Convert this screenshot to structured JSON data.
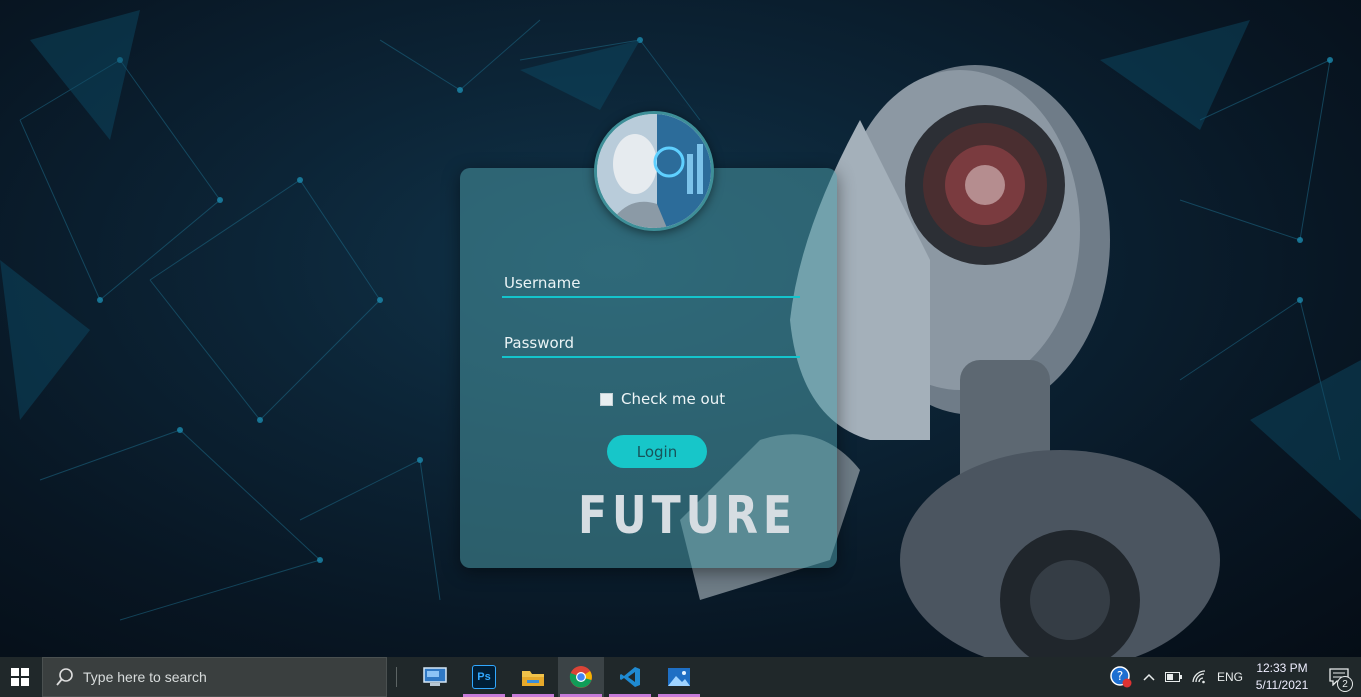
{
  "login": {
    "username_placeholder": "Username",
    "password_placeholder": "Password",
    "checkbox_label": "Check me out",
    "login_label": "Login",
    "brand_text": "FUTURE"
  },
  "taskbar": {
    "search_placeholder": "Type here to search",
    "apps": [
      {
        "name": "remote-desktop-icon"
      },
      {
        "name": "photoshop-icon",
        "label": "Ps"
      },
      {
        "name": "file-explorer-icon"
      },
      {
        "name": "chrome-icon"
      },
      {
        "name": "vscode-icon"
      },
      {
        "name": "photos-icon"
      }
    ],
    "tray": {
      "language": "ENG",
      "time": "12:33 PM",
      "date": "5/11/2021",
      "notification_count": "2"
    }
  },
  "colors": {
    "accent": "#17c6c9",
    "card": "#4896a0",
    "taskbar": "#20282a"
  }
}
